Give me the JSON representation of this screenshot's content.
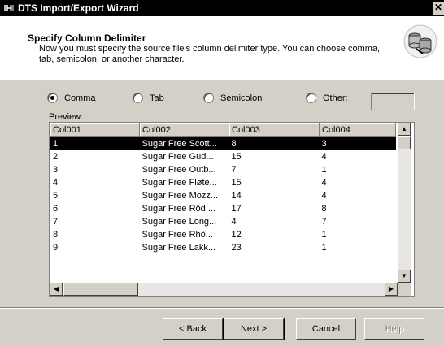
{
  "window": {
    "title": "DTS Import/Export Wizard",
    "close_glyph": "✕"
  },
  "header": {
    "title": "Specify Column Delimiter",
    "description": "Now you must specify the source file's column delimiter type.  You can choose comma, tab, semicolon, or another character.",
    "icon": "database-transfer-icon"
  },
  "delimiters": [
    {
      "label": "Comma",
      "selected": true
    },
    {
      "label": "Tab",
      "selected": false
    },
    {
      "label": "Semicolon",
      "selected": false
    },
    {
      "label": "Other:",
      "selected": false
    }
  ],
  "other_value": "",
  "preview": {
    "label": "Preview:",
    "columns": [
      "Col001",
      "Col002",
      "Col003",
      "Col004"
    ],
    "selected_row": 0,
    "rows": [
      [
        "1",
        "Sugar Free Scott...",
        "8",
        "3"
      ],
      [
        "2",
        "Sugar Free Gud...",
        "15",
        "4"
      ],
      [
        "3",
        "Sugar Free Outb...",
        "7",
        "1"
      ],
      [
        "4",
        "Sugar Free Fløte...",
        "15",
        "4"
      ],
      [
        "5",
        "Sugar Free Mozz...",
        "14",
        "4"
      ],
      [
        "6",
        "Sugar Free Röd ...",
        "17",
        "8"
      ],
      [
        "7",
        "Sugar Free Long...",
        "4",
        "7"
      ],
      [
        "8",
        "Sugar Free Rhö...",
        "12",
        "1"
      ],
      [
        "9",
        "Sugar Free Lakk...",
        "23",
        "1"
      ]
    ]
  },
  "buttons": {
    "back": "< Back",
    "next": "Next >",
    "cancel": "Cancel",
    "help": "Help"
  }
}
